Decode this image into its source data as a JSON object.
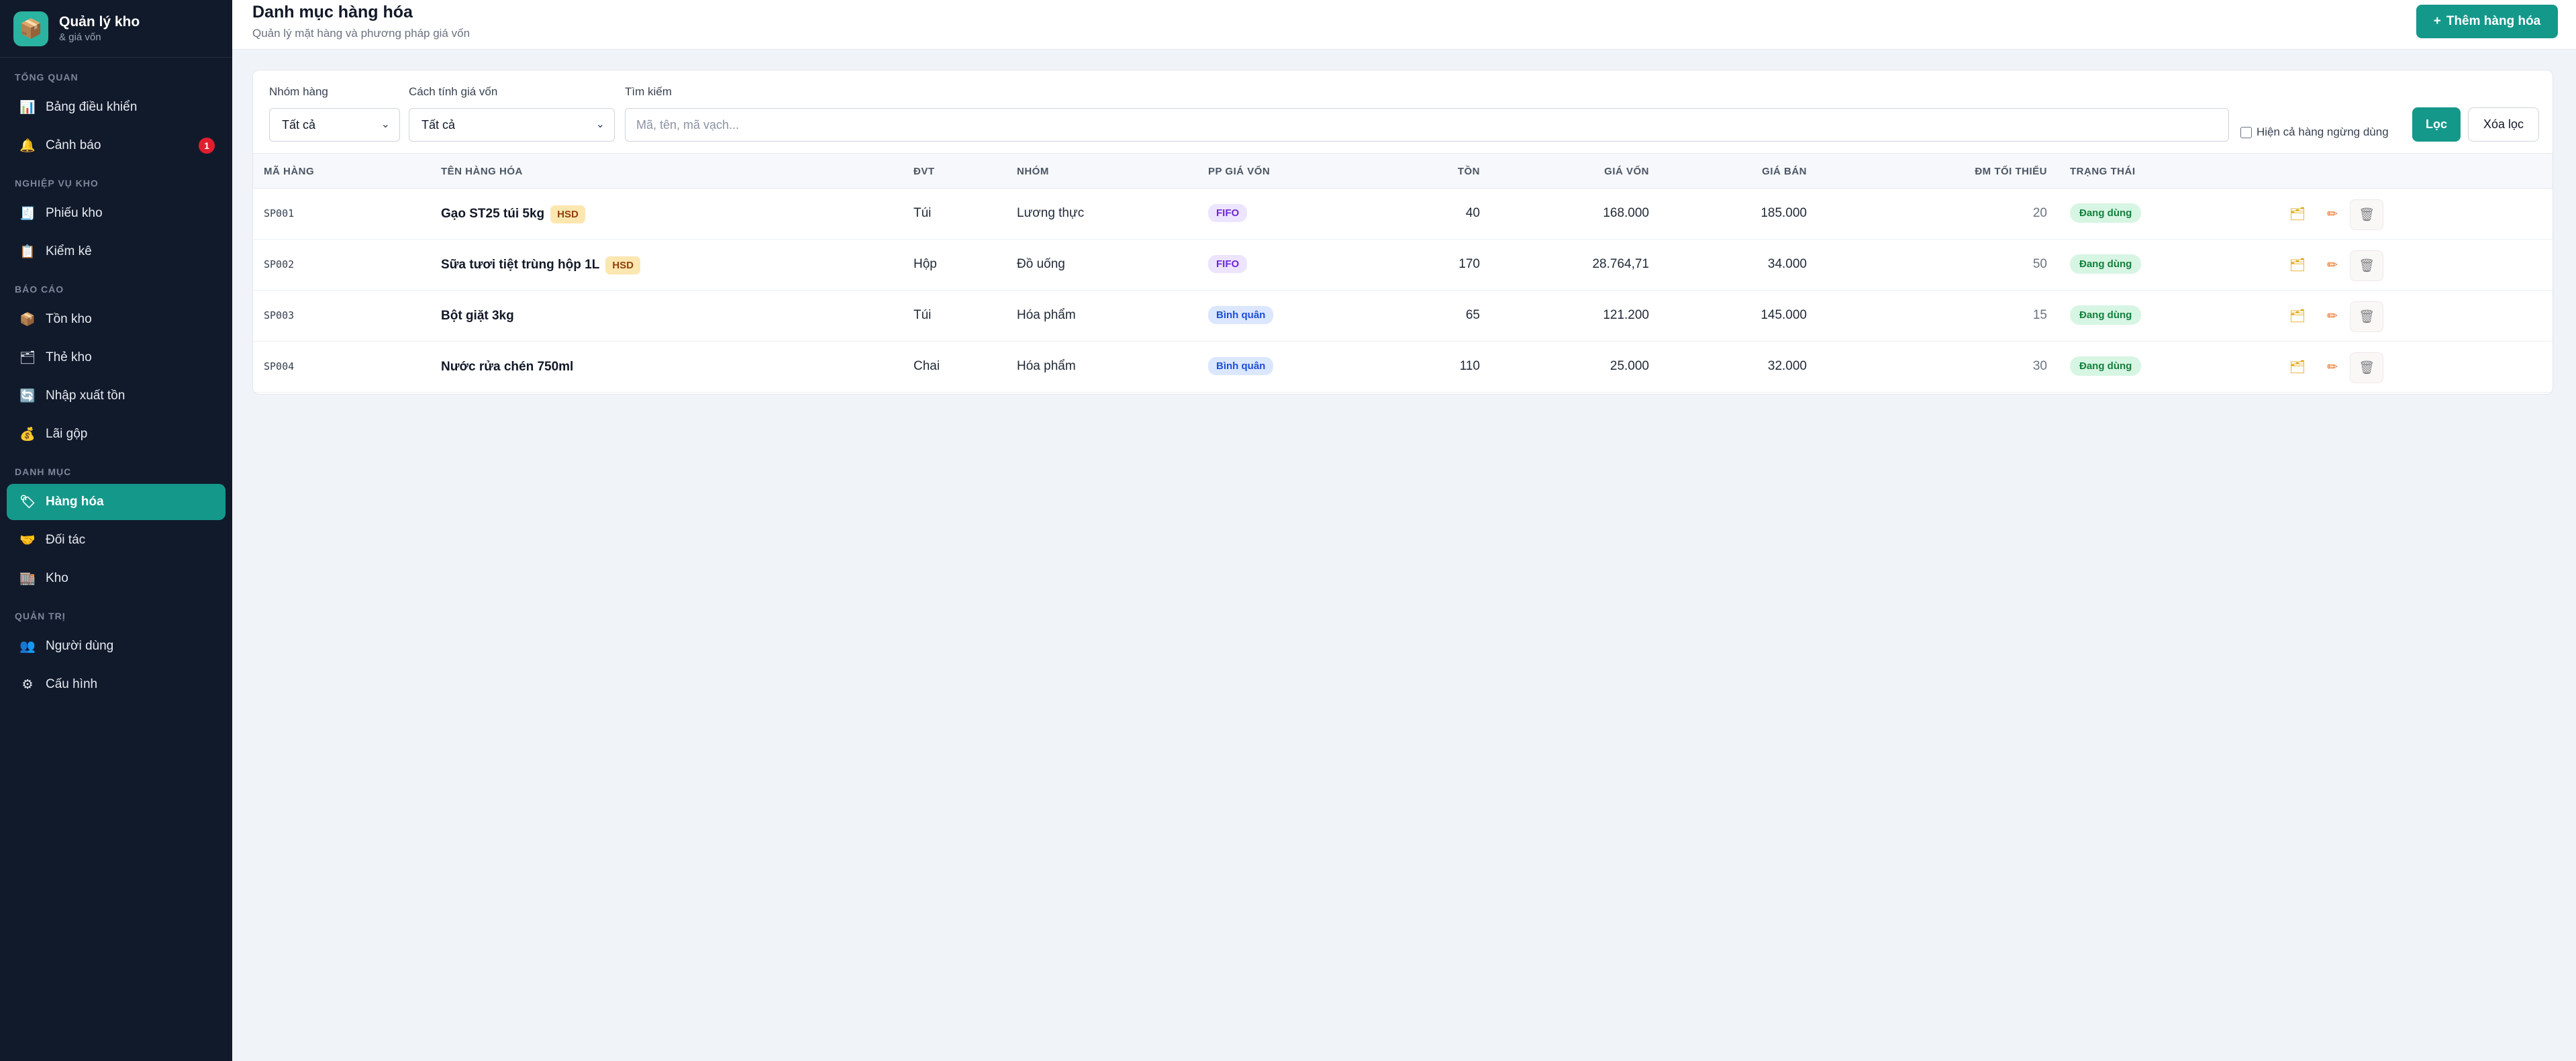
{
  "brand": {
    "title": "Quản lý kho",
    "subtitle": "& giá vốn",
    "logo_icon": "📦"
  },
  "sidebar": {
    "sections": [
      {
        "label": "TỔNG QUAN",
        "items": [
          {
            "label": "Bảng điều khiển",
            "icon": "📊"
          },
          {
            "label": "Cảnh báo",
            "icon": "🔔",
            "badge": "1"
          }
        ]
      },
      {
        "label": "NGHIỆP VỤ KHO",
        "items": [
          {
            "label": "Phiếu kho",
            "icon": "🧾"
          },
          {
            "label": "Kiểm kê",
            "icon": "📋"
          }
        ]
      },
      {
        "label": "BÁO CÁO",
        "items": [
          {
            "label": "Tồn kho",
            "icon": "📦"
          },
          {
            "label": "Thẻ kho",
            "icon": "🗂"
          },
          {
            "label": "Nhập xuất tồn",
            "icon": "🔄"
          },
          {
            "label": "Lãi gộp",
            "icon": "💰"
          }
        ]
      },
      {
        "label": "DANH MỤC",
        "items": [
          {
            "label": "Hàng hóa",
            "icon": "🏷",
            "active": true
          },
          {
            "label": "Đối tác",
            "icon": "🤝"
          },
          {
            "label": "Kho",
            "icon": "🏬"
          }
        ]
      },
      {
        "label": "QUẢN TRỊ",
        "items": [
          {
            "label": "Người dùng",
            "icon": "👥"
          },
          {
            "label": "Cấu hình",
            "icon": "⚙"
          }
        ]
      }
    ]
  },
  "header": {
    "title": "Danh mục hàng hóa",
    "subtitle": "Quản lý mặt hàng và phương pháp giá vốn",
    "add_button": "Thêm hàng hóa",
    "add_icon": "+"
  },
  "filters": {
    "group_label": "Nhóm hàng",
    "group_value": "Tất cả",
    "cost_label": "Cách tính giá vốn",
    "cost_value": "Tất cả",
    "search_label": "Tìm kiếm",
    "search_placeholder": "Mã, tên, mã vạch...",
    "show_inactive_label": "Hiện cả hàng ngừng dùng",
    "filter_button": "Lọc",
    "clear_button": "Xóa lọc"
  },
  "table": {
    "columns": [
      "MÃ HÀNG",
      "TÊN HÀNG HÓA",
      "ĐVT",
      "NHÓM",
      "PP GIÁ VỐN",
      "TỒN",
      "GIÁ VỐN",
      "GIÁ BÁN",
      "ĐM TỐI THIỂU",
      "TRẠNG THÁI"
    ],
    "rows": [
      {
        "code": "SP001",
        "name": "Gạo ST25 túi 5kg",
        "tag": "HSD",
        "unit": "Túi",
        "group": "Lương thực",
        "method": "FIFO",
        "method_kind": "fifo",
        "stock": "40",
        "cost": "168.000",
        "price": "185.000",
        "min": "20",
        "status": "Đang dùng"
      },
      {
        "code": "SP002",
        "name": "Sữa tươi tiệt trùng hộp 1L",
        "tag": "HSD",
        "unit": "Hộp",
        "group": "Đồ uống",
        "method": "FIFO",
        "method_kind": "fifo",
        "stock": "170",
        "cost": "28.764,71",
        "price": "34.000",
        "min": "50",
        "status": "Đang dùng"
      },
      {
        "code": "SP003",
        "name": "Bột giặt 3kg",
        "tag": "",
        "unit": "Túi",
        "group": "Hóa phẩm",
        "method": "Bình quân",
        "method_kind": "bq",
        "stock": "65",
        "cost": "121.200",
        "price": "145.000",
        "min": "15",
        "status": "Đang dùng"
      },
      {
        "code": "SP004",
        "name": "Nước rửa chén 750ml",
        "tag": "",
        "unit": "Chai",
        "group": "Hóa phẩm",
        "method": "Bình quân",
        "method_kind": "bq",
        "stock": "110",
        "cost": "25.000",
        "price": "32.000",
        "min": "30",
        "status": "Đang dùng"
      }
    ],
    "row_actions": [
      {
        "name": "stock-card-icon",
        "glyph": "🗂"
      },
      {
        "name": "edit-icon",
        "glyph": "✏"
      },
      {
        "name": "delete-icon",
        "glyph": "🗑"
      }
    ]
  },
  "colors": {
    "accent": "#14988a",
    "sidebar_bg": "#111a2b",
    "danger": "#e11d2e"
  }
}
